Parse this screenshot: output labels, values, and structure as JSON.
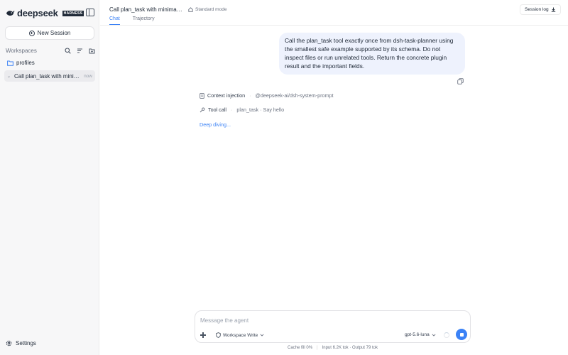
{
  "sidebar": {
    "brand": "deepseek",
    "brand_badge": "HARNESS",
    "new_session_label": "New Session",
    "workspaces_label": "Workspaces",
    "workspace": {
      "folder_name": "profiles",
      "sessions": [
        {
          "title": "Call plan_task with minimal exam",
          "time": "now"
        }
      ]
    },
    "settings_label": "Settings"
  },
  "header": {
    "session_title": "Call plan_task with minimal ex...",
    "mode_label": "Standard mode",
    "session_log_label": "Session log",
    "tabs": [
      {
        "label": "Chat",
        "active": true
      },
      {
        "label": "Trajectory",
        "active": false
      }
    ]
  },
  "chat": {
    "user_message": "Call the plan_task tool exactly once from dsh-task-planner using the smallest safe example supported by its schema. Do not inspect files or run unrelated tools. Return the concrete plugin result and the important fields.",
    "context_injection": {
      "label": "Context injection",
      "detail": "@deepseek-ai/dsh-system-prompt"
    },
    "tool_call": {
      "label": "Tool call",
      "detail": "plan_task · Say hello"
    },
    "status_text": "Deep diving..."
  },
  "composer": {
    "placeholder": "Message the agent",
    "value": "",
    "permission_label": "Workspace Write",
    "model_label": "gpt-5.6-luna"
  },
  "footer": {
    "cache_fill": "Cache fill 0%",
    "tokens": "Input 6.2K tok · Output 79 tok"
  },
  "colors": {
    "accent": "#3b82f6",
    "user_bubble": "#eef2fd",
    "sidebar_bg": "#f7f7f8"
  }
}
